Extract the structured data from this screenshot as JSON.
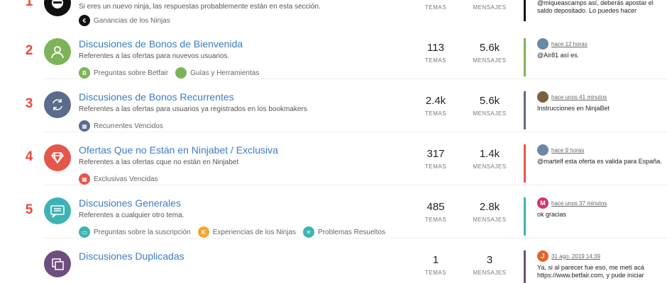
{
  "labels": {
    "topics": "TEMAS",
    "posts": "MENSAJES"
  },
  "categories": [
    {
      "rank": "1",
      "title": "",
      "description": "Si eres un nuevo ninja, las respuestas probablemente están en esta sección.",
      "icon": "ninja-icon",
      "color": "#111111",
      "subcategories": [
        {
          "label": "Ganancias de los Ninjas",
          "icon": "euro-icon",
          "color": "#111111"
        }
      ],
      "topics": "",
      "posts": "",
      "accent": "#111111",
      "latest": {
        "time": "",
        "text": "@miqueascamps así, deberás apostar el saldo depositado. Lo puedes hacer"
      }
    },
    {
      "rank": "2",
      "title": "Discusiones de Bonos de Bienvenida",
      "description": "Referentes a las ofertas para nuvevos usuarios.",
      "icon": "user-icon",
      "color": "#7db359",
      "subcategories": [
        {
          "label": "Preguntas sobre Betfair",
          "icon": "b-icon",
          "color": "#7db359"
        },
        {
          "label": "Guías y Herramientas",
          "icon": "circle-icon",
          "color": "#7db359"
        }
      ],
      "topics": "113",
      "posts": "5.6k",
      "accent": "#7db359",
      "latest": {
        "time": "hace 12 horas",
        "text": "@Air81 así es."
      }
    },
    {
      "rank": "3",
      "title": "Discusiones de Bonos Recurrentes",
      "description": "Referentes a las ofertas para usuarios ya registrados en los bookmakers",
      "icon": "refresh-icon",
      "color": "#5b6b8c",
      "subcategories": [
        {
          "label": "Recurrentes Vencidos",
          "icon": "calendar-icon",
          "color": "#5b6b8c"
        }
      ],
      "topics": "2.4k",
      "posts": "5.6k",
      "accent": "#5b6b8c",
      "latest": {
        "time": "hace unos 41 minutos",
        "text": "Instrucciones en NinjaBet"
      }
    },
    {
      "rank": "4",
      "title": "Ofertas Que no Están en Ninjabet / Exclusiva",
      "description": "Referentes a las ofertas cque no están en Ninjabet",
      "icon": "diamond-icon",
      "color": "#e5564b",
      "subcategories": [
        {
          "label": "Exclusivas Vencidas",
          "icon": "calendar-icon",
          "color": "#e5564b"
        }
      ],
      "topics": "317",
      "posts": "1.4k",
      "accent": "#e5564b",
      "latest": {
        "time": "hace 9 horas",
        "text": "@martelf esta oferta es valida para España."
      }
    },
    {
      "rank": "5",
      "title": "Discusiones Generales",
      "description": "Referentes a cualquier otro tema.",
      "icon": "chat-icon",
      "color": "#3fb3b4",
      "subcategories": [
        {
          "label": "Preguntas sobre la suscripción",
          "icon": "card-icon",
          "color": "#3fb3b4"
        },
        {
          "label": "Experiencias de los Ninjas",
          "icon": "k-icon",
          "color": "#f0a830"
        },
        {
          "label": "Problemas Resueltos",
          "icon": "x-icon",
          "color": "#3fb3b4"
        }
      ],
      "topics": "485",
      "posts": "2.8k",
      "accent": "#3fb3b4",
      "latest": {
        "time": "hace unos 37 minutos",
        "text": "ok gracias"
      }
    },
    {
      "rank": "",
      "title": "Discusiones Duplicadas",
      "description": "",
      "icon": "copy-icon",
      "color": "#6e4e7e",
      "subcategories": [],
      "topics": "1",
      "posts": "3",
      "accent": "#6e4e7e",
      "latest": {
        "time": "31 ago. 2019 14:39",
        "text": "Ya, si al parecer fue eso, me metí acá https://www.betfair.com, y pude iniciar"
      }
    }
  ],
  "avatars": [
    {
      "letter": "",
      "color": "#8a7a6a"
    },
    {
      "letter": "",
      "color": "#6a88a8"
    },
    {
      "letter": "",
      "color": "#7a6040"
    },
    {
      "letter": "",
      "color": "#6a88a8"
    },
    {
      "letter": "M",
      "color": "#d6336c"
    },
    {
      "letter": "J",
      "color": "#e8632b"
    }
  ]
}
